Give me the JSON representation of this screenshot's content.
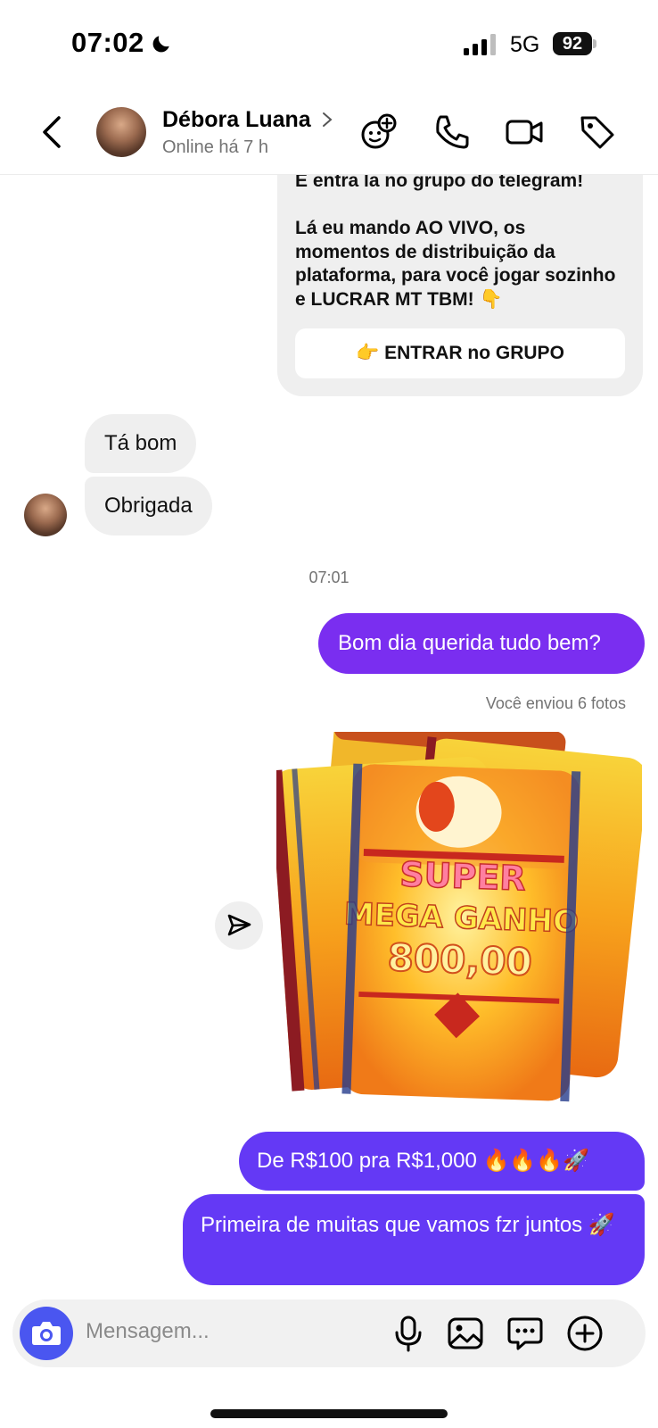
{
  "status_bar": {
    "time": "07:02",
    "network": "5G",
    "battery": "92"
  },
  "header": {
    "contact_name": "Débora Luana",
    "contact_status": "Online há 7 h"
  },
  "messages": {
    "received_card": {
      "text": "E entra la no grupo do telegram!\n\nLá eu mando AO VIVO, os momentos de distribuição da plataforma, para você jogar sozinho e LUCRAR MT TBM! 👇",
      "button_label": "👉 ENTRAR no GRUPO"
    },
    "received_1": "Tá bom",
    "received_2": "Obrigada",
    "timestamp": "07:01",
    "sent_1": "Bom dia querida tudo bem?",
    "sent_photos_label": "Você enviou 6 fotos",
    "photo_text": {
      "line1": "SUPER",
      "line2": "MEGA GANHO",
      "amount": "800,00"
    },
    "sent_2": "De R$100 pra R$1,000 🔥🔥🔥🚀",
    "sent_3": "Primeira de muitas que vamos fzr juntos 🚀"
  },
  "composer": {
    "placeholder": "Mensagem..."
  },
  "colors": {
    "sent_bubble_purple": "#7a2ef0",
    "sent_bubble_indigo": "#6439f5",
    "received_bubble": "#efefef",
    "camera_button": "#4a56f0"
  }
}
